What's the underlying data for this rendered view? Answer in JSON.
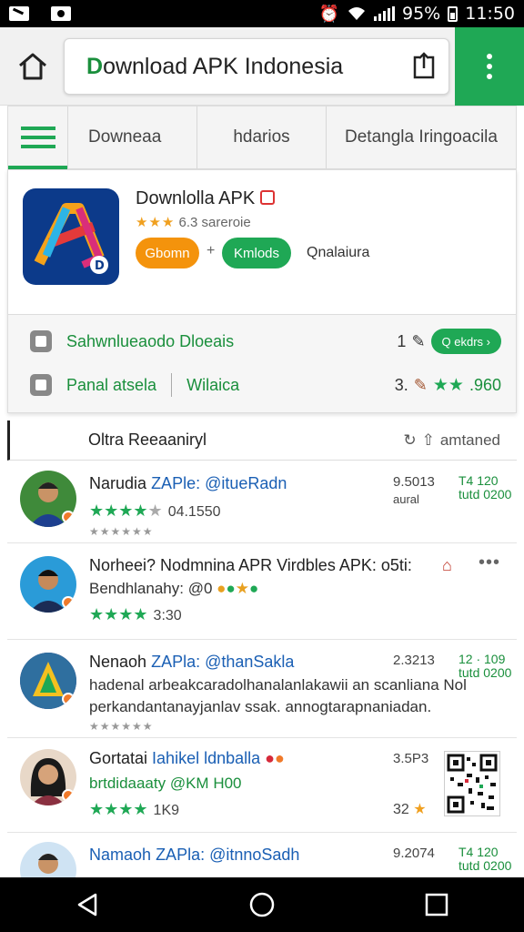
{
  "status_bar": {
    "battery_text": "95%",
    "time": "11:50",
    "icons": [
      "notification-icon",
      "image-icon",
      "alarm-icon",
      "wifi-icon",
      "signal-icon",
      "battery-icon"
    ]
  },
  "browser": {
    "url_first_letter": "D",
    "url_rest": "ownload APK Indonesia",
    "accent": "#1fa855"
  },
  "tabs": [
    {
      "label": "",
      "icon": "menu-icon"
    },
    {
      "label": "Downeaa"
    },
    {
      "label": "hdarios"
    },
    {
      "label": "Detangla Iringoacila"
    }
  ],
  "app": {
    "title": "Downlolla APK",
    "rating_stars": "★★★",
    "rating_text": "6.3 sareroie",
    "pill_orange": "Gbomn",
    "pill_plus": "+",
    "pill_green": "Kmlods",
    "extra": "Qnalaiura",
    "info_row_1_label": "Sahwnlueaodo Dloeais",
    "info_row_1_num": "1",
    "info_row_1_pill": "Q ekdrs ›",
    "info_row_2_label": "Panal atsela",
    "info_row_2_sub": "Wilaica",
    "info_row_2_num": "3.",
    "info_row_2_score": ".960"
  },
  "reviews_header": {
    "title": "Oltra Reeaaniryl",
    "sort": "amtaned"
  },
  "reviews": [
    {
      "name": "Narudia",
      "handle": "ZAPle: @itueRadn",
      "stars": "★★★★",
      "number": "04.1550",
      "date": "9.5013",
      "sub": "aural",
      "badge_1": "T4 120",
      "badge_2": "tutd 0200"
    },
    {
      "name": "Norheei? Nodmnina APR Virdbles APK: o5ti:",
      "handle": "Bendhlanahy: @0",
      "stars": "★★★★",
      "number": "3:30"
    },
    {
      "name": "Nenaoh",
      "handle": "ZAPla: @thanSakla",
      "text_1": "hadenal arbeakcaradolhanalanlakawii an scanliana Nol",
      "text_2": "perkandantanayjanlav ssak. annogtarapnaniadan.",
      "date": "2.3213",
      "badge_1": "12 · 109",
      "badge_2": "tutd 0200"
    },
    {
      "name": "Gortatai",
      "handle": "Iahikel ldnballa",
      "text_1": "brtdidaaaty @KM H00",
      "stars": "★★★★",
      "number": "1K9",
      "date": "3.5P3",
      "right_num": "32"
    },
    {
      "name": "Namaoh",
      "handle": "ZAPla: @itnnoSadh",
      "date": "9.2074",
      "badge_1": "T4 120",
      "badge_2": "tutd 0200"
    }
  ]
}
